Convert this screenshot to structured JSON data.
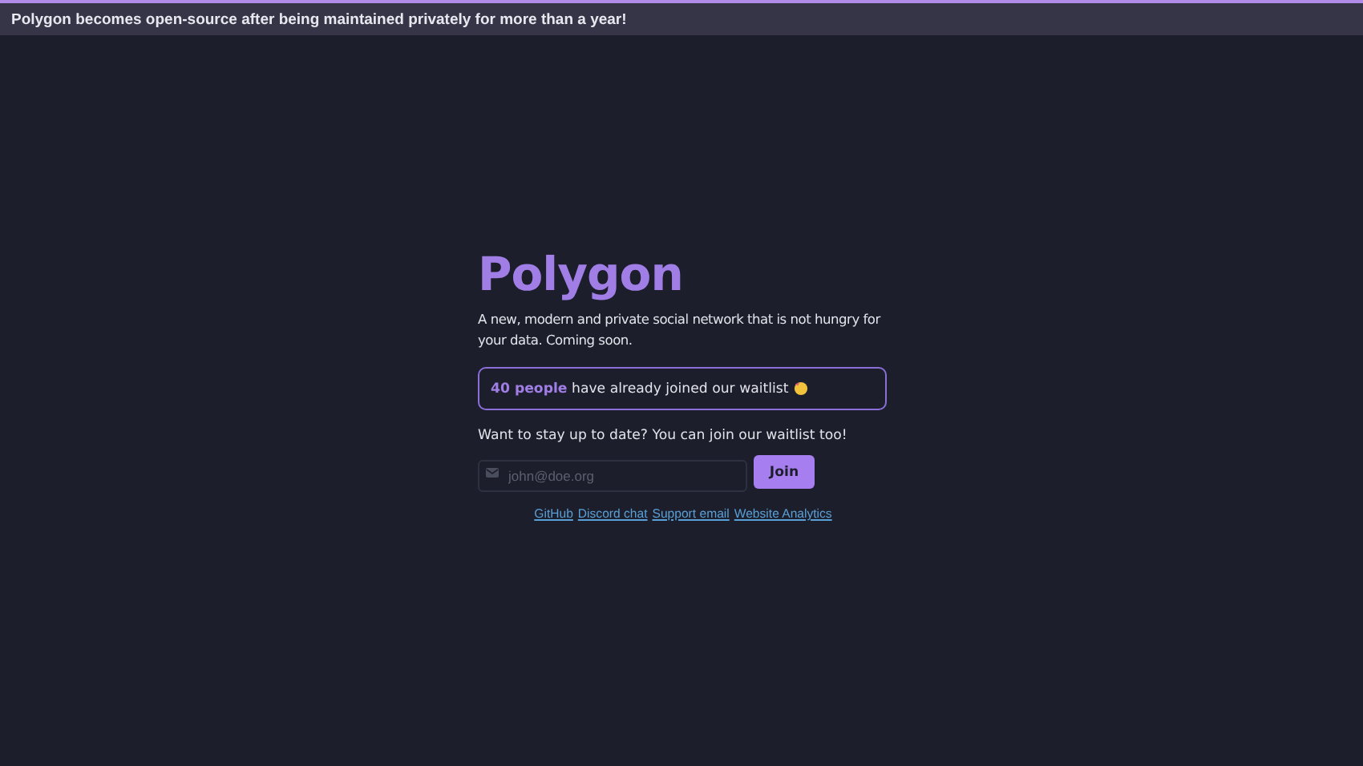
{
  "banner": {
    "text": "Polygon becomes open-source after being maintained privately for more than a year!"
  },
  "title": "Polygon",
  "tagline": "A new, modern and private social network that is not hungry for your data. Coming soon.",
  "waitlist_notice": {
    "count": "40 people",
    "text": "have already joined our waitlist"
  },
  "prompt": "Want to stay up to date? You can join our waitlist too!",
  "email_field": {
    "placeholder": "john@doe.org"
  },
  "join_button": "Join",
  "links": [
    "GitHub",
    "Discord chat",
    "Support email",
    "Website Analytics"
  ]
}
